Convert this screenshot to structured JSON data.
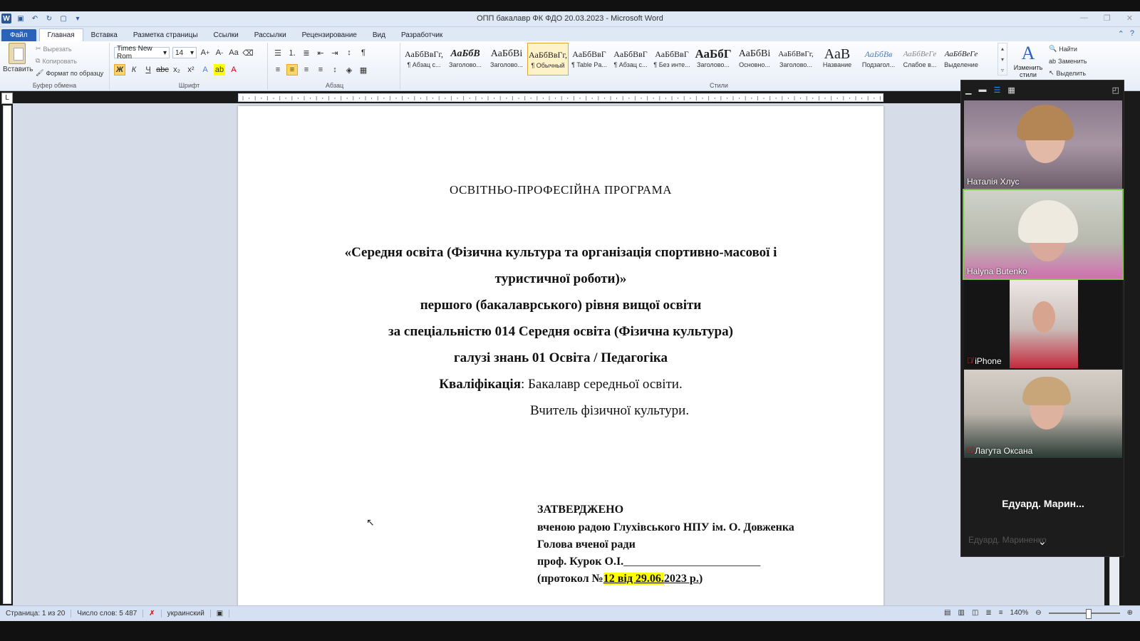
{
  "window": {
    "title": "ОПП бакалавр ФК ФДО 20.03.2023  -  Microsoft Word"
  },
  "tabs": [
    {
      "label": "Файл"
    },
    {
      "label": "Главная"
    },
    {
      "label": "Вставка"
    },
    {
      "label": "Разметка страницы"
    },
    {
      "label": "Ссылки"
    },
    {
      "label": "Рассылки"
    },
    {
      "label": "Рецензирование"
    },
    {
      "label": "Вид"
    },
    {
      "label": "Разработчик"
    }
  ],
  "ribbon": {
    "clipboard": {
      "paste": "Вставить",
      "cut": "Вырезать",
      "copy": "Копировать",
      "format_painter": "Формат по образцу",
      "label": "Буфер обмена"
    },
    "font": {
      "family": "Times New Rom",
      "size": "14",
      "label": "Шрифт"
    },
    "paragraph": {
      "label": "Абзац"
    },
    "styles": {
      "label": "Стили",
      "items": [
        {
          "sample": "АаБбВвГг,",
          "name": "¶ Абзац с..."
        },
        {
          "sample": "АаБбВ",
          "name": "Заголово..."
        },
        {
          "sample": "АаБбВі",
          "name": "Заголово..."
        },
        {
          "sample": "АаБбВвГг,",
          "name": "¶ Обычный"
        },
        {
          "sample": "АаБбВвГ",
          "name": "¶ Table Pa..."
        },
        {
          "sample": "АаБбВвГ",
          "name": "¶ Абзац с..."
        },
        {
          "sample": "АаБбВвГ",
          "name": "¶ Без инте..."
        },
        {
          "sample": "АаБбГ",
          "name": "Заголово..."
        },
        {
          "sample": "АаБбВі",
          "name": "Основно..."
        },
        {
          "sample": "АаБбВвГг,",
          "name": "Заголово..."
        },
        {
          "sample": "АаВ",
          "name": "Название"
        },
        {
          "sample": "АаБбВв",
          "name": "Подзагол..."
        },
        {
          "sample": "АаБбВеГе",
          "name": "Слабое в..."
        },
        {
          "sample": "АаБбВеГе",
          "name": "Выделение"
        }
      ],
      "change_styles": "Изменить стили"
    },
    "editing": {
      "find": "Найти",
      "replace": "Заменить",
      "select": "Выделить"
    }
  },
  "document": {
    "title": "ОСВІТНЬО-ПРОФЕСІЙНА  ПРОГРАМА",
    "line1": "«Середня освіта (Фізична культура та організація спортивно-масової і",
    "line2": "туристичної роботи)»",
    "line3": "першого (бакалаврського) рівня вищої освіти",
    "line4": "за спеціальністю 014 Середня освіта (Фізична культура)",
    "line5": "галузі знань 01 Освіта / Педагогіка",
    "qual_label": "Кваліфікація",
    "qual_value": ": Бакалавр середньої освіти.",
    "qual_value2": "Вчитель фізичної культури.",
    "approved": {
      "title": "ЗАТВЕРДЖЕНО",
      "line1": "вченою радою Глухівського  НПУ ім. О. Довженка",
      "line2": "Голова вченої ради",
      "line3": "проф. Курок  О.І.",
      "signature_blank": "________________________",
      "protocol_prefix": "(протокол  №",
      "protocol_num": "12",
      "protocol_from": " від ",
      "protocol_date": "29.06.",
      "protocol_year": "2023 р.",
      "protocol_close": ")"
    }
  },
  "statusbar": {
    "page": "Страница: 1 из 20",
    "words": "Число слов: 5 487",
    "language": "украинский",
    "zoom": "140%"
  },
  "video": {
    "participants": [
      {
        "name": "Наталія Хлус",
        "muted": false,
        "speaking": false
      },
      {
        "name": "Halyna Butenko",
        "muted": false,
        "speaking": true
      },
      {
        "name": "iPhone",
        "muted": true,
        "speaking": false
      },
      {
        "name": "Лагута Оксана",
        "muted": true,
        "speaking": false
      }
    ],
    "text_tile": {
      "label": "Едуард.  Марин...",
      "sub": "Едуард. Мариненко"
    }
  }
}
